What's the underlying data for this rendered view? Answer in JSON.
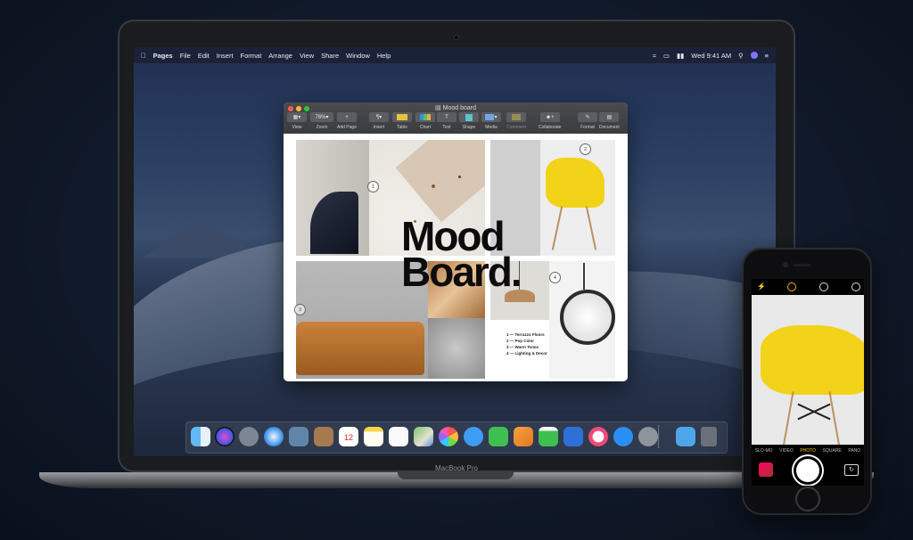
{
  "menubar": {
    "app": "Pages",
    "items": [
      "File",
      "Edit",
      "Insert",
      "Format",
      "Arrange",
      "View",
      "Share",
      "Window",
      "Help"
    ],
    "clock": "Wed 9:41 AM"
  },
  "window": {
    "title": "Mood board",
    "zoom": "76%",
    "toolbar": [
      {
        "label": "View",
        "icon": "sidebar-icon"
      },
      {
        "label": "Zoom",
        "icon": "zoom-icon"
      },
      {
        "label": "Add Page",
        "icon": "plus-icon"
      },
      {
        "label": "Insert",
        "icon": "paragraph-icon"
      },
      {
        "label": "Table",
        "icon": "table-icon"
      },
      {
        "label": "Chart",
        "icon": "chart-icon"
      },
      {
        "label": "Text",
        "icon": "text-icon"
      },
      {
        "label": "Shape",
        "icon": "shape-icon"
      },
      {
        "label": "Media",
        "icon": "media-icon"
      },
      {
        "label": "Comment",
        "icon": "comment-icon"
      },
      {
        "label": "Collaborate",
        "icon": "collaborate-icon"
      },
      {
        "label": "Format",
        "icon": "format-icon"
      },
      {
        "label": "Document",
        "icon": "document-icon"
      }
    ]
  },
  "document": {
    "headline_line1": "Mood",
    "headline_line2": "Board.",
    "markers": [
      "1",
      "2",
      "3",
      "4"
    ],
    "legend": [
      "1  —  Terrazzo Floors",
      "2  —  Pop Color",
      "3  —  Warm Tones",
      "4  —  Lighting & Decor"
    ]
  },
  "dock": {
    "icons": [
      "finder-icon",
      "siri-icon",
      "launchpad-icon",
      "safari-icon",
      "photos-app-icon",
      "contacts-icon",
      "calendar-icon",
      "notes-icon",
      "reminders-icon",
      "maps-icon",
      "photos-icon",
      "messages-icon",
      "facetime-icon",
      "pages-icon",
      "numbers-icon",
      "keynote-icon",
      "itunes-icon",
      "app-store-icon",
      "system-preferences-icon",
      "downloads-folder-icon",
      "trash-icon"
    ],
    "calendar_day": "12"
  },
  "macbook": {
    "label": "MacBook Pro"
  },
  "iphone": {
    "modes": [
      "SLO-MO",
      "VIDEO",
      "PHOTO",
      "SQUARE",
      "PANO"
    ],
    "active_mode": "PHOTO"
  },
  "colors": {
    "accent_yellow": "#f3d21a",
    "camera_active": "#ffcc00"
  }
}
